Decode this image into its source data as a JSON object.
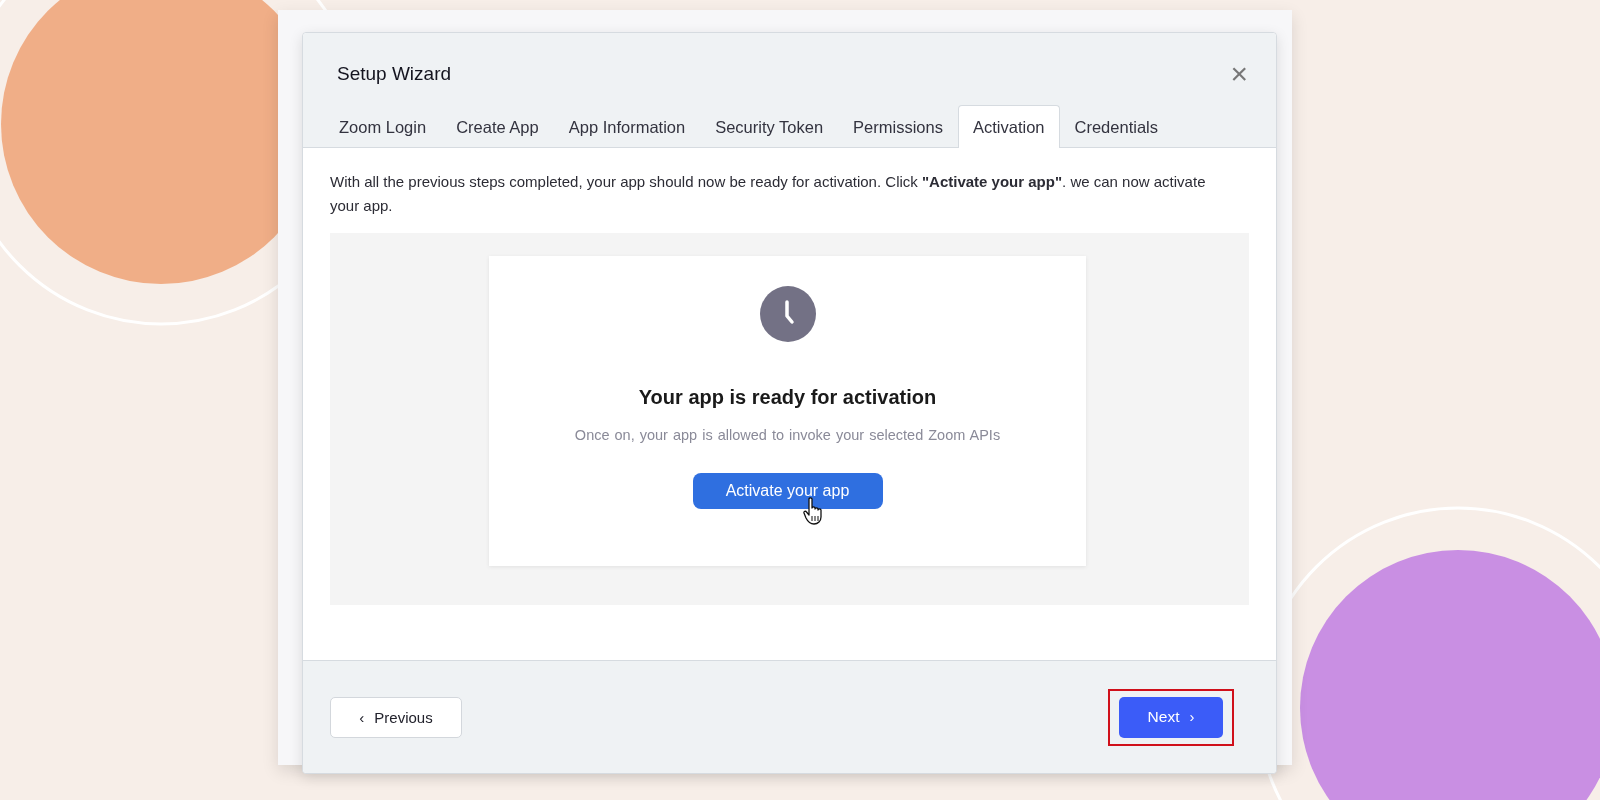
{
  "dialog": {
    "title": "Setup Wizard",
    "close": "×"
  },
  "tabs": [
    {
      "label": "Zoom Login",
      "selected": false
    },
    {
      "label": "Create App",
      "selected": false
    },
    {
      "label": "App Information",
      "selected": false
    },
    {
      "label": "Security Token",
      "selected": false
    },
    {
      "label": "Permissions",
      "selected": false
    },
    {
      "label": "Activation",
      "selected": true
    },
    {
      "label": "Credentials",
      "selected": false
    }
  ],
  "instructions": "With all the previous steps completed, your app should now be ready for activation. Click **\"Activate your app\"**. we can now activate your app.",
  "preview": {
    "heading": "Your app is ready for activation",
    "description": "Once on, your app is allowed to invoke your selected Zoom APIs",
    "button": "Activate your app"
  },
  "footer": {
    "previous": {
      "label": "Previous",
      "icon": "‹"
    },
    "next": {
      "label": "Next",
      "icon": "›",
      "highlighted": true
    }
  }
}
